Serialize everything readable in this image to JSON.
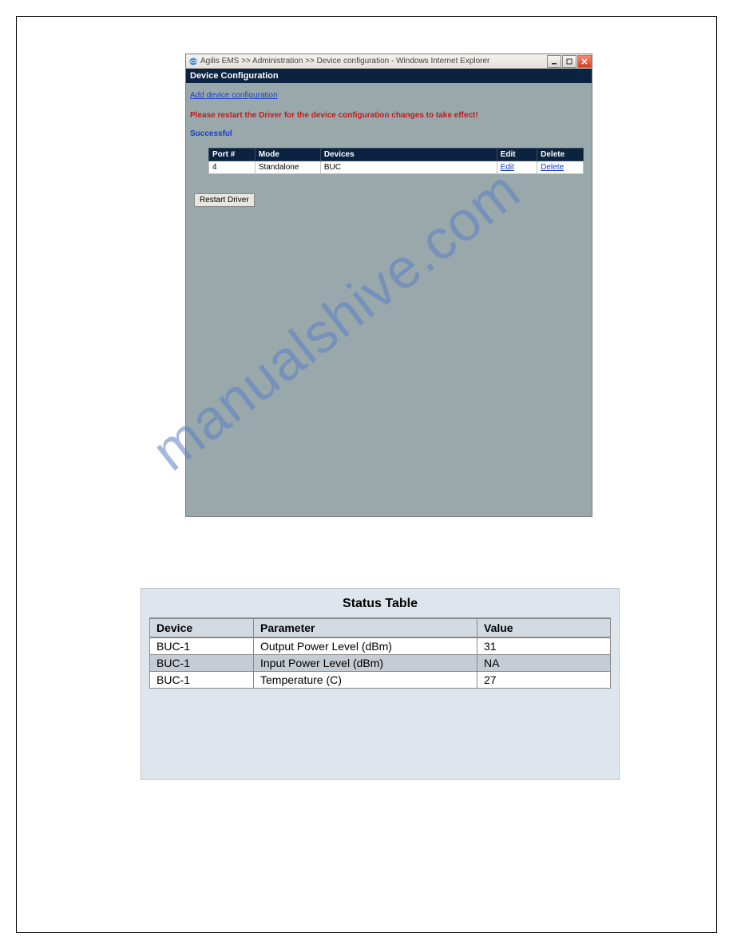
{
  "ie_window": {
    "title": "Agilis EMS >> Administration >> Device configuration - Windows Internet Explorer",
    "header": "Device Configuration",
    "add_link": "Add device configuration",
    "warning": "Please restart the Driver for the device configuration changes to take effect!",
    "success": "Successful",
    "table": {
      "headers": [
        "Port #",
        "Mode",
        "Devices",
        "Edit",
        "Delete"
      ],
      "row": {
        "port": "4",
        "mode": "Standalone",
        "devices": "BUC",
        "edit": "Edit",
        "delete": "Delete"
      }
    },
    "restart_button": "Restart Driver"
  },
  "watermark": "manualshive.com",
  "status_panel": {
    "title": "Status Table",
    "headers": [
      "Device",
      "Parameter",
      "Value"
    ],
    "rows": [
      {
        "device": "BUC-1",
        "parameter": "Output Power Level (dBm)",
        "value": "31"
      },
      {
        "device": "BUC-1",
        "parameter": "Input Power Level (dBm)",
        "value": "NA"
      },
      {
        "device": "BUC-1",
        "parameter": "Temperature (C)",
        "value": "27"
      }
    ]
  }
}
